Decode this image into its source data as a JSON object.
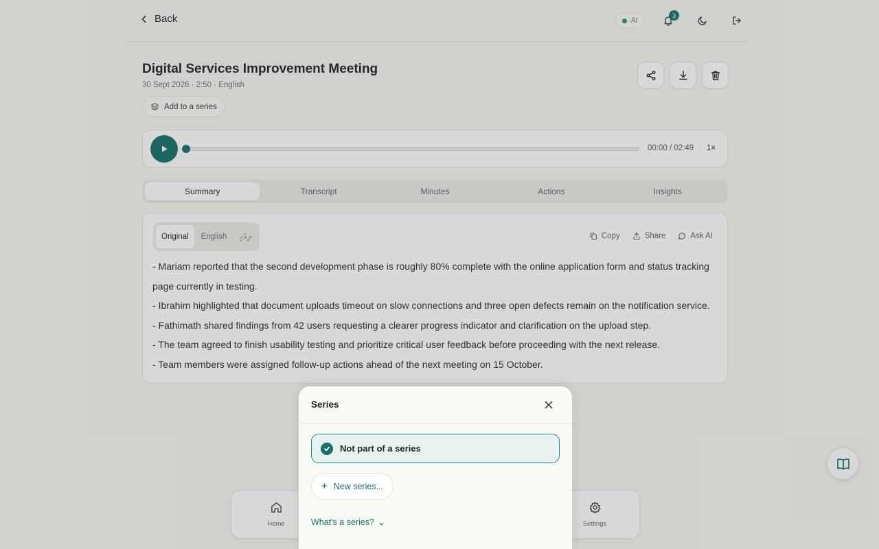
{
  "header": {
    "back_label": "Back",
    "ai_label": "AI",
    "notification_count": "3"
  },
  "meeting": {
    "title": "Digital Services Improvement Meeting",
    "meta": "30 Sept 2026 · 2:50 · English",
    "add_series_label": "Add to a series"
  },
  "player": {
    "time": "00:00 / 02:49",
    "speed": "1×",
    "progress_fraction": 0
  },
  "tabs": [
    {
      "label": "Summary",
      "active": true
    },
    {
      "label": "Transcript",
      "active": false
    },
    {
      "label": "Minutes",
      "active": false
    },
    {
      "label": "Actions",
      "active": false
    },
    {
      "label": "Insights",
      "active": false
    }
  ],
  "summary": {
    "languages": [
      {
        "label": "Original",
        "active": true
      },
      {
        "label": "English",
        "active": false
      },
      {
        "label": "ދިވެހި",
        "active": false
      }
    ],
    "tools": {
      "copy": "Copy",
      "share": "Share",
      "ask_ai": "Ask AI"
    },
    "points": [
      "- Mariam reported that the second development phase is roughly 80% complete with the online application form and status tracking page currently in testing.",
      "- Ibrahim highlighted that document uploads timeout on slow connections and three open defects remain on the notification service.",
      "- Fathimath shared findings from 42 users requesting a clearer progress indicator and clarification on the upload step.",
      "- The team agreed to finish usability testing and prioritize critical user feedback before proceeding with the next release.",
      "- Team members were assigned follow-up actions ahead of the next meeting on 15 October."
    ]
  },
  "bottom_nav": {
    "home": "Home",
    "settings": "Settings"
  },
  "modal": {
    "title": "Series",
    "selected_option": "Not part of a series",
    "new_series": "New series...",
    "whats_series": "What's a series?"
  },
  "colors": {
    "accent": "#17706b",
    "selected_bg": "#e7f1ef"
  },
  "icons": {
    "back": "chevron-left-icon",
    "notifications": "bell-icon",
    "theme": "moon-icon",
    "logout": "logout-icon",
    "share": "share-icon",
    "download": "download-icon",
    "delete": "trash-icon",
    "play": "play-icon",
    "home": "home-icon",
    "settings": "gear-icon",
    "guide": "book-icon",
    "close": "close-icon",
    "check": "check-icon"
  }
}
